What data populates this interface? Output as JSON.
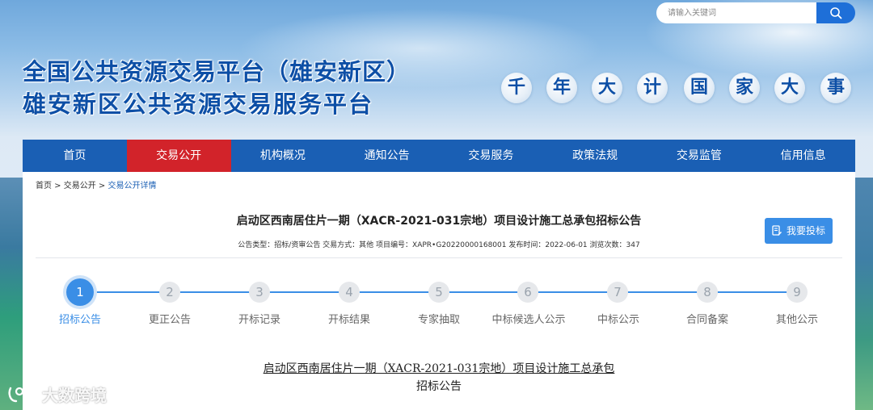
{
  "search": {
    "placeholder": "请输入关键词"
  },
  "header": {
    "title_line1": "全国公共资源交易平台（雄安新区）",
    "title_line2": "雄安新区公共资源交易服务平台",
    "slogan": [
      "千",
      "年",
      "大",
      "计",
      "国",
      "家",
      "大",
      "事"
    ]
  },
  "nav": {
    "items": [
      "首页",
      "交易公开",
      "机构概况",
      "通知公告",
      "交易服务",
      "政策法规",
      "交易监管",
      "信用信息"
    ],
    "active_index": 1
  },
  "breadcrumb": {
    "home": "首页",
    "sep1": " > ",
    "section": "交易公开",
    "sep2": " > ",
    "current": "交易公开详情"
  },
  "notice": {
    "title": "启动区西南居住片一期（XACR-2021-031宗地）项目设计施工总承包招标公告",
    "meta": "公告类型：招标/资审公告 交易方式：其他 项目编号：XAPR•G20220000168001 发布时间：2022-06-01 浏览次数：347",
    "bid_button": "我要投标"
  },
  "steps": {
    "current": 1,
    "items": [
      {
        "num": "1",
        "label": "招标公告"
      },
      {
        "num": "2",
        "label": "更正公告"
      },
      {
        "num": "3",
        "label": "开标记录"
      },
      {
        "num": "4",
        "label": "开标结果"
      },
      {
        "num": "5",
        "label": "专家抽取"
      },
      {
        "num": "6",
        "label": "中标候选人公示"
      },
      {
        "num": "7",
        "label": "中标公示"
      },
      {
        "num": "8",
        "label": "合同备案"
      },
      {
        "num": "9",
        "label": "其他公示"
      }
    ]
  },
  "document": {
    "title_line1": "启动区西南居住片一期（XACR-2021-031宗地）项目设计施工总承包",
    "title_line2": "招标公告"
  },
  "watermark": {
    "text": "大数跨境"
  },
  "colors": {
    "nav_bg": "#1a5fb4",
    "nav_active": "#d2232a",
    "accent": "#3a8ee6",
    "title": "#0d4fa6"
  }
}
